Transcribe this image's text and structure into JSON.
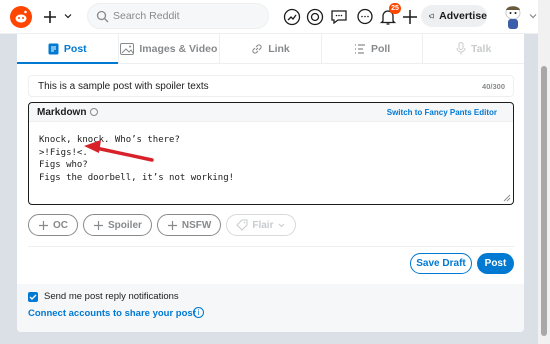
{
  "header": {
    "search_placeholder": "Search Reddit",
    "notification_count": "25",
    "advertise_label": "Advertise"
  },
  "tabs": [
    {
      "label": "Post",
      "icon": "document-icon",
      "state": "active"
    },
    {
      "label": "Images & Video",
      "icon": "image-icon",
      "state": "normal"
    },
    {
      "label": "Link",
      "icon": "link-icon",
      "state": "normal"
    },
    {
      "label": "Poll",
      "icon": "poll-icon",
      "state": "normal"
    },
    {
      "label": "Talk",
      "icon": "mic-icon",
      "state": "disabled"
    }
  ],
  "title_field": {
    "value": "This is a sample post with spoiler texts",
    "counter": "40/300"
  },
  "editor": {
    "mode_label": "Markdown",
    "switch_label": "Switch to Fancy Pants Editor",
    "lines": [
      "Knock, knock. Who’s there?",
      ">!Figs!<.",
      "Figs who?",
      "Figs the doorbell, it’s not working!"
    ]
  },
  "flair_buttons": [
    {
      "label": "OC",
      "icon": "plus-icon"
    },
    {
      "label": "Spoiler",
      "icon": "plus-icon"
    },
    {
      "label": "NSFW",
      "icon": "plus-icon"
    },
    {
      "label": "Flair",
      "icon": "tag-icon",
      "state": "disabled"
    }
  ],
  "actions": {
    "save_draft": "Save Draft",
    "post": "Post"
  },
  "footer": {
    "notifications_label": "Send me post reply notifications",
    "notifications_checked": true,
    "connect_label": "Connect accounts to share your post"
  },
  "colors": {
    "accent": "#0079d3",
    "brand": "#ff4500",
    "annotation_arrow": "#d8222a"
  }
}
